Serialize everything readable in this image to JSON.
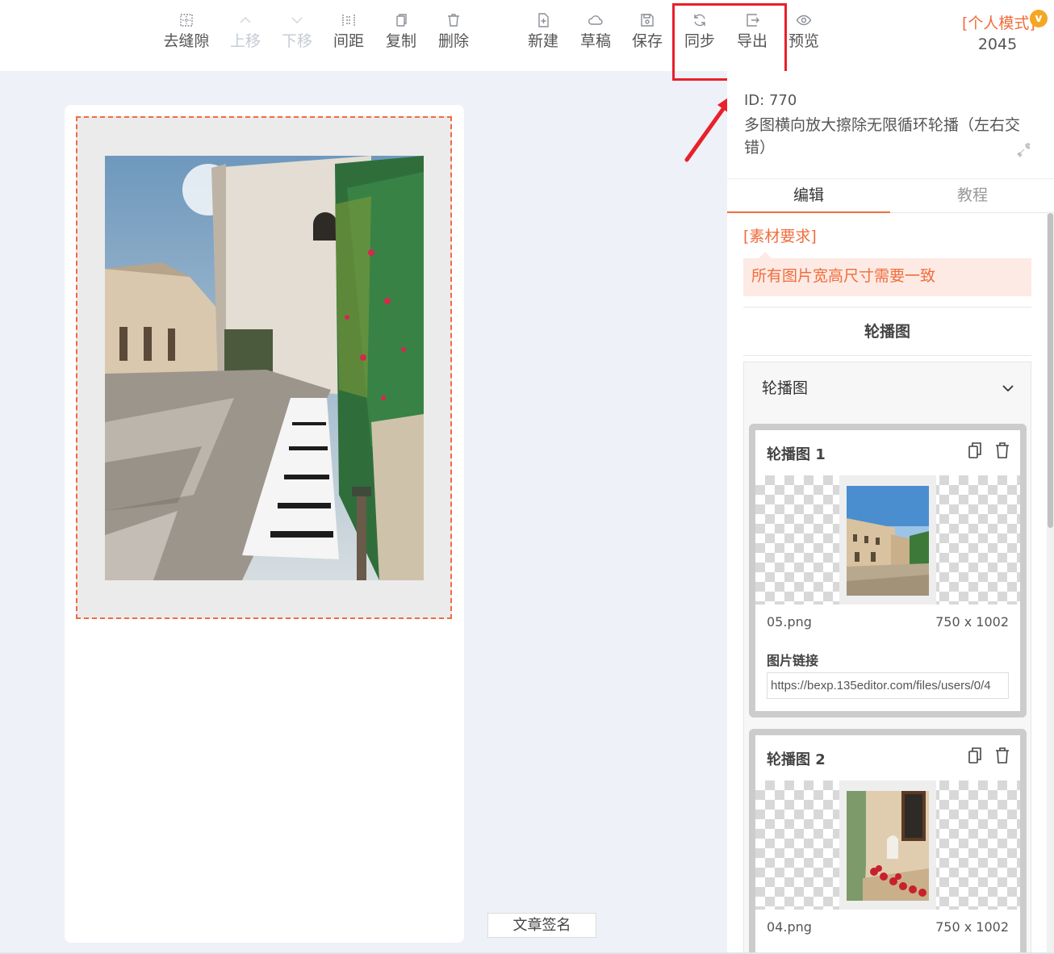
{
  "toolbar": {
    "buttons": [
      {
        "label": "去缝隙",
        "icon": "gap-remove-icon",
        "disabled": false
      },
      {
        "label": "上移",
        "icon": "chevron-up-icon",
        "disabled": true
      },
      {
        "label": "下移",
        "icon": "chevron-down-icon",
        "disabled": true
      },
      {
        "label": "间距",
        "icon": "spacing-icon",
        "disabled": false
      },
      {
        "label": "复制",
        "icon": "copy-icon",
        "disabled": false
      },
      {
        "label": "删除",
        "icon": "trash-icon",
        "disabled": false
      },
      {
        "label": "新建",
        "icon": "new-file-icon",
        "disabled": false
      },
      {
        "label": "草稿",
        "icon": "cloud-icon",
        "disabled": false
      },
      {
        "label": "保存",
        "icon": "save-icon",
        "disabled": false
      },
      {
        "label": "同步",
        "icon": "sync-icon",
        "disabled": false
      },
      {
        "label": "导出",
        "icon": "export-icon",
        "disabled": false
      },
      {
        "label": "预览",
        "icon": "eye-icon",
        "disabled": false
      }
    ],
    "mode_label": "[个人模式]",
    "vip_badge": "v",
    "count": "2045"
  },
  "template": {
    "id_label": "ID: 770",
    "name": "多图横向放大擦除无限循环轮播（左右交错）"
  },
  "tabs": [
    {
      "label": "编辑",
      "active": true
    },
    {
      "label": "教程",
      "active": false
    }
  ],
  "requirements": {
    "title": "[素材要求]",
    "text": "所有图片宽高尺寸需要一致"
  },
  "section": {
    "title": "轮播图",
    "accordion_title": "轮播图"
  },
  "carousel_items": [
    {
      "title": "轮播图 1",
      "filename": "05.png",
      "size": "750 x 1002",
      "link_label": "图片链接",
      "link_value": "https://bexp.135editor.com/files/users/0/4"
    },
    {
      "title": "轮播图 2",
      "filename": "04.png",
      "size": "750 x 1002"
    }
  ],
  "footer": {
    "signature_button": "文章签名"
  },
  "colors": {
    "accent": "#f06d3c",
    "highlight": "#e8202a",
    "background": "#eef1f7"
  }
}
